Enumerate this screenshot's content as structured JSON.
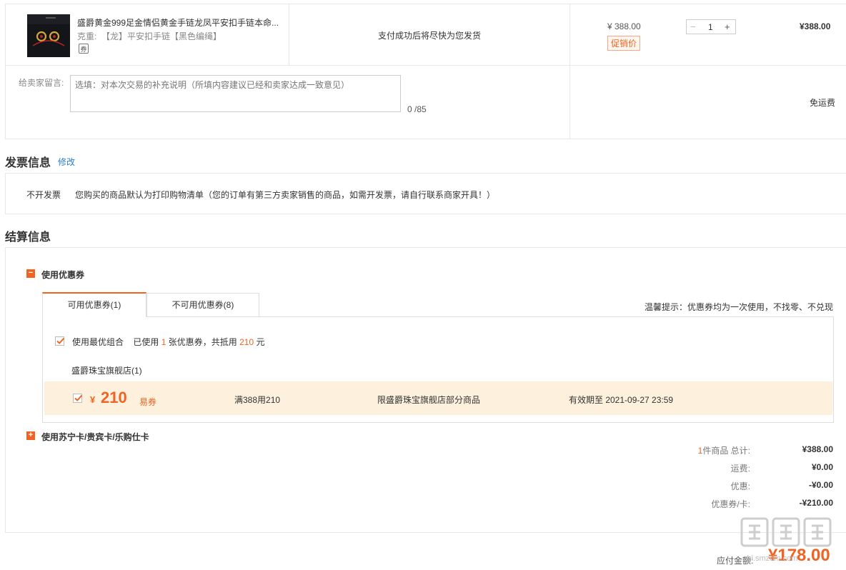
{
  "product": {
    "title": "盛爵黄金999足金情侣黄金手链龙凤平安扣手链本命...",
    "spec_label": "克重:",
    "spec_value": "【龙】平安扣手链【黑色编绳】",
    "ship_note": "支付成功后将尽快为您发货",
    "unit_price": "¥ 388.00",
    "promo_tag": "促销价",
    "quantity": "1",
    "subtotal": "¥388.00"
  },
  "message": {
    "label": "给卖家留言:",
    "placeholder": "选填：对本次交易的补充说明（所填内容建议已经和卖家达成一致意见）",
    "count": "0 /85",
    "shipping": "免运费"
  },
  "invoice": {
    "title": "发票信息",
    "edit": "修改",
    "type": "不开发票",
    "desc": "您购买的商品默认为打印购物清单（您的订单有第三方卖家销售的商品，如需开发票，请自行联系商家开具！）"
  },
  "settlement": {
    "title": "结算信息",
    "coupon_section": "使用优惠券",
    "tab_available": "可用优惠券(1)",
    "tab_unavailable": "不可用优惠券(8)",
    "tip": "温馨提示：优惠券均为一次使用，不找零、不兑现",
    "best_combo": "使用最优组合",
    "used_prefix": "已使用",
    "used_count": "1",
    "used_mid": "张优惠券，共抵用",
    "used_amount": "210",
    "used_suffix": "元",
    "store": "盛爵珠宝旗舰店(1)",
    "coupon": {
      "currency": "¥",
      "amount": "210",
      "type": "易券",
      "rule": "满388用210",
      "scope": "限盛爵珠宝旗舰店部分商品",
      "expiry": "有效期至 2021-09-27 23:59"
    },
    "card_section": "使用苏宁卡/贵宾卡/乐购仕卡"
  },
  "summary": {
    "count": "1",
    "count_label": "件商品 总计:",
    "total": "¥388.00",
    "freight_label": "运费:",
    "freight": "¥0.00",
    "discount_label": "优惠:",
    "discount": "-¥0.00",
    "coupon_label": "优惠券/卡:",
    "coupon": "-¥210.00",
    "pay_label": "应付金额:",
    "pay_total": "¥178.00"
  },
  "watermark": {
    "logo_text": "值值值",
    "site": "zhi.smzdm.com"
  },
  "colors": {
    "accent": "#f06322",
    "link": "#2c7ec5",
    "coupon_bg": "#fdf1de"
  }
}
